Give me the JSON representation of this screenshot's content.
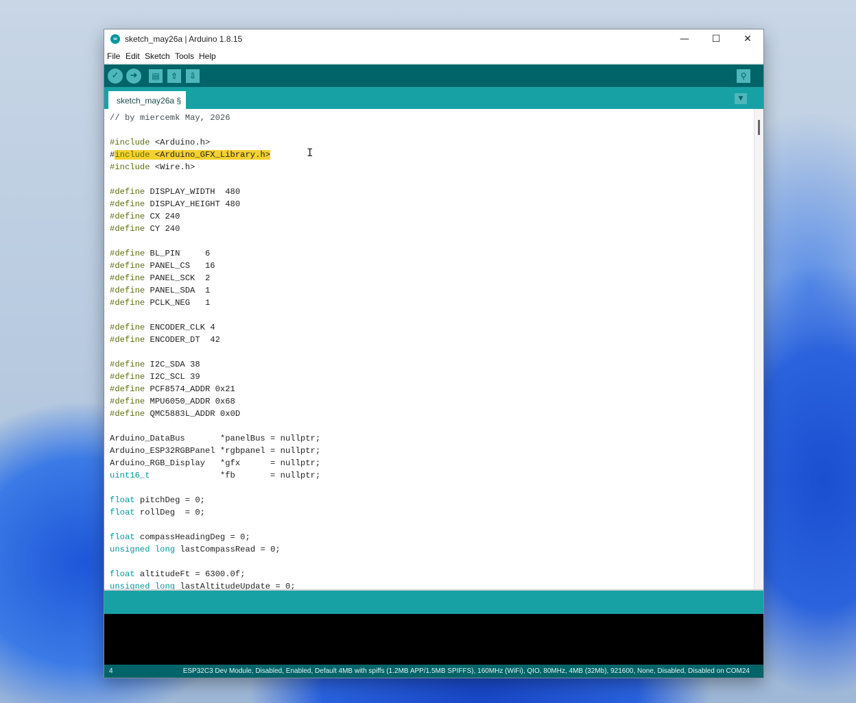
{
  "window": {
    "title": "sketch_may26a | Arduino 1.8.15",
    "app_icon": "arduino-icon",
    "controls": {
      "minimize": "—",
      "maximize": "☐",
      "close": "✕"
    }
  },
  "menu": {
    "items": [
      "File",
      "Edit",
      "Sketch",
      "Tools",
      "Help"
    ]
  },
  "toolbar": {
    "verify": "✓",
    "upload": "➜",
    "new": "▤",
    "open": "⇧",
    "save": "⇩",
    "serial_monitor": "⚲"
  },
  "tabs": {
    "active": "sketch_may26a §",
    "menu": "▼"
  },
  "editor": {
    "cursor": "I",
    "lines": [
      "// by miercemk May, 2026",
      "",
      "#include <Arduino.h>",
      "#include <Arduino_GFX_Library.h>",
      "#include <Wire.h>",
      "",
      "#define DISPLAY_WIDTH  480",
      "#define DISPLAY_HEIGHT 480",
      "#define CX 240",
      "#define CY 240",
      "",
      "#define BL_PIN     6",
      "#define PANEL_CS   16",
      "#define PANEL_SCK  2",
      "#define PANEL_SDA  1",
      "#define PCLK_NEG   1",
      "",
      "#define ENCODER_CLK 4",
      "#define ENCODER_DT  42",
      "",
      "#define I2C_SDA 38",
      "#define I2C_SCL 39",
      "#define PCF8574_ADDR 0x21",
      "#define MPU6050_ADDR 0x68",
      "#define QMC5883L_ADDR 0x0D",
      "",
      "Arduino_DataBus       *panelBus = nullptr;",
      "Arduino_ESP32RGBPanel *rgbpanel = nullptr;",
      "Arduino_RGB_Display   *gfx      = nullptr;",
      "uint16_t              *fb       = nullptr;",
      "",
      "float pitchDeg = 0;",
      "float rollDeg  = 0;",
      "",
      "float compassHeadingDeg = 0;",
      "unsigned long lastCompassRead = 0;",
      "",
      "float altitudeFt = 6300.0f;",
      "unsigned long lastAltitudeUpdate = 0;"
    ]
  },
  "footer": {
    "line_number": "4",
    "board_info": "ESP32C3 Dev Module, Disabled, Enabled, Default 4MB with spiffs (1.2MB APP/1.5MB SPIFFS), 160MHz (WiFi), QIO, 80MHz, 4MB (32Mb), 921600, None, Disabled, Disabled on COM24"
  }
}
